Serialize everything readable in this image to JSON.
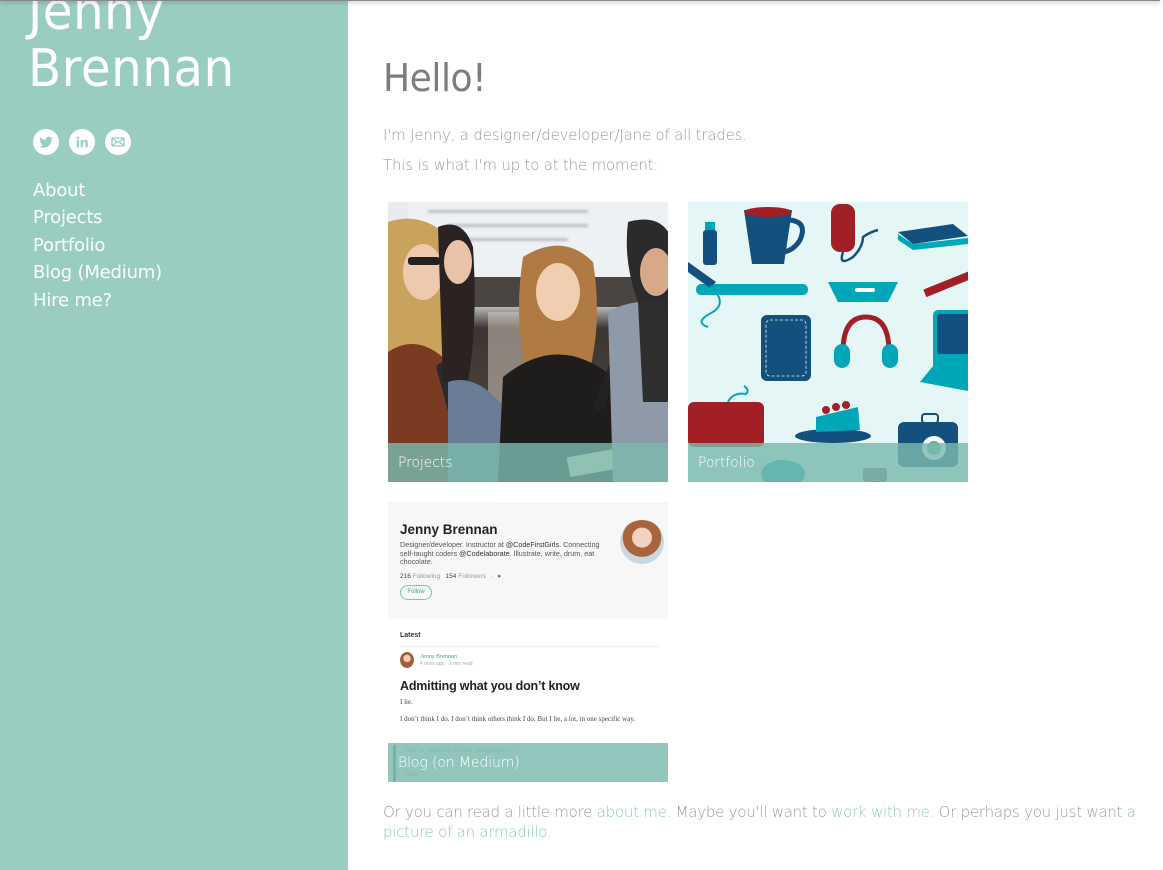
{
  "colors": {
    "sidebar_bg": "#9acdc2",
    "caption_bg": "#7ab9ad",
    "heading_text": "#7d7d7d",
    "body_text": "#9b9b9b",
    "link": "#8ec8bb"
  },
  "sidebar": {
    "name_line1": "Jenny",
    "name_line2": "Brennan",
    "social": [
      {
        "icon": "twitter-icon",
        "label": "Twitter"
      },
      {
        "icon": "linkedin-icon",
        "label": "LinkedIn"
      },
      {
        "icon": "email-icon",
        "label": "Email"
      }
    ],
    "nav": [
      {
        "label": "About"
      },
      {
        "label": "Projects"
      },
      {
        "label": "Portfolio"
      },
      {
        "label": "Blog (Medium)"
      },
      {
        "label": "Hire me?"
      }
    ]
  },
  "main": {
    "title": "Hello!",
    "intro_line1": "I'm Jenny, a designer/developer/Jane of all trades.",
    "intro_line2": "This is what I'm up to at the moment:",
    "cards": [
      {
        "caption": "Projects"
      },
      {
        "caption": "Portfolio"
      },
      {
        "caption": "Blog (on Medium)",
        "preview": {
          "profile_name": "Jenny Brennan",
          "bio_part1": "Designer/developer. Instructor at ",
          "bio_handle1": "@CodeFirstGirls",
          "bio_part2": ". Connecting self-taught coders ",
          "bio_handle2": "@Codelaborate",
          "bio_part3": ". Illustrate, write, drum, eat chocolate.",
          "following_count": "216",
          "following_label": "Following",
          "followers_count": "154",
          "followers_label": "Followers",
          "follow_button": "Follow",
          "latest_label": "Latest",
          "author": "Jenny Brennan",
          "meta": "4 mins ago · 2 min read",
          "post_title": "Admitting what you don’t know",
          "post_line1": "I lie.",
          "post_line2": "I don’t think I do. I don’t think others think I do. But I lie, a lot, in one specific way.",
          "quote1": "“You’ve heard of nuclear nanoprobes?”",
          "quote2": "“Sure”"
        }
      }
    ],
    "outro": {
      "text1": "Or you can read a little more ",
      "link1": "about me.",
      "text2": " Maybe you'll want to ",
      "link2": "work with me.",
      "text3": " Or perhaps you just want ",
      "link3": "a picture of an armadillo."
    }
  }
}
